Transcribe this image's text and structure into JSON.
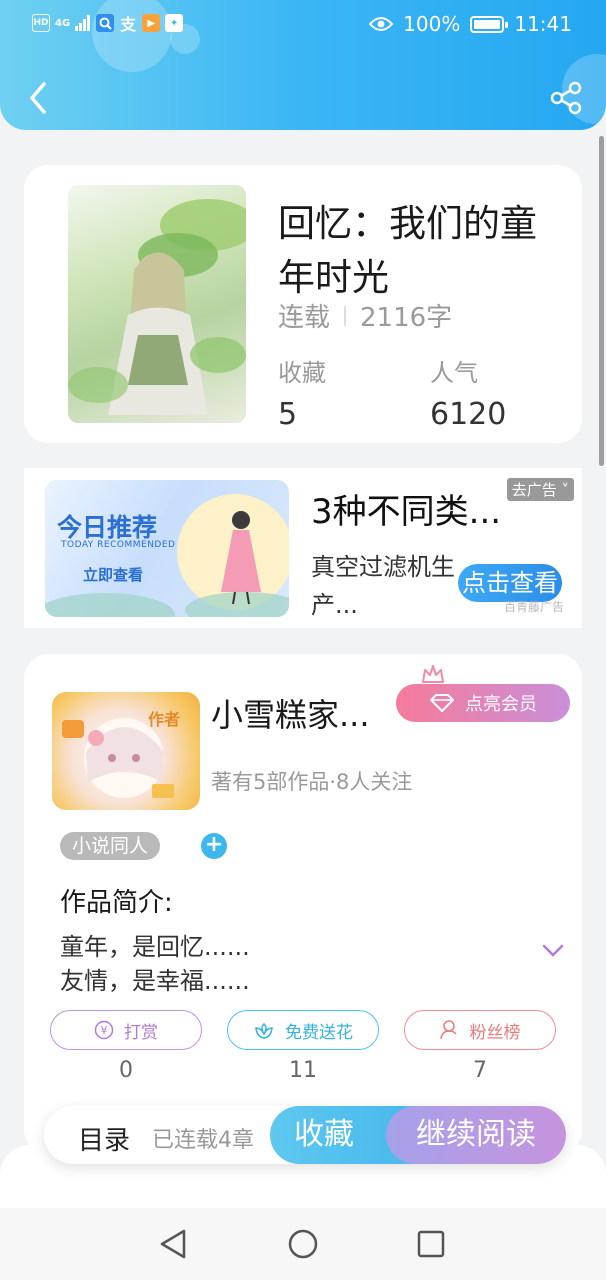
{
  "status_bar": {
    "left_icons": [
      "hd-icon",
      "signal-4g-icon",
      "search-app-icon",
      "alipay-icon",
      "video-app-icon",
      "bird-app-icon"
    ],
    "network": "4G",
    "battery_percent": "100%",
    "time": "11:41"
  },
  "book": {
    "title": "回忆：我们的童年时光",
    "status": "连载",
    "word_count": "2116字",
    "favorites_label": "收藏",
    "favorites_value": "5",
    "popularity_label": "人气",
    "popularity_value": "6120"
  },
  "ad": {
    "image_title": "今日推荐",
    "image_subtitle": "TODAY RECOMMENDED",
    "image_cta": "立即查看",
    "title": "3种不同类...",
    "description": "真空过滤机生产...",
    "close_label": "去广告",
    "button": "点击查看",
    "source": "百青藤广告"
  },
  "author": {
    "avatar_badge": "作者",
    "name": "小雪糕家...",
    "vip_button": "点亮会员",
    "subtitle": "著有5部作品·8人关注",
    "tag": "小说同人",
    "intro_heading": "作品简介:",
    "intro_lines": [
      "童年，是回忆......",
      "友情，是幸福......"
    ],
    "actions": [
      {
        "label": "打赏",
        "count": "0",
        "color": "#c58fe0"
      },
      {
        "label": "免费送花",
        "count": "11",
        "color": "#4fc3e8"
      },
      {
        "label": "粉丝榜",
        "count": "7",
        "color": "#f08f8f"
      }
    ]
  },
  "bottom_bar": {
    "toc": "目录",
    "chapters": "已连载4章",
    "favorite": "收藏",
    "continue": "继续阅读"
  },
  "colors": {
    "header_start": "#6fd0f2",
    "header_end": "#25a7f1",
    "accent_blue": "#40b4ec",
    "accent_purple": "#c694dd",
    "vip_pink": "#f57b9a"
  }
}
